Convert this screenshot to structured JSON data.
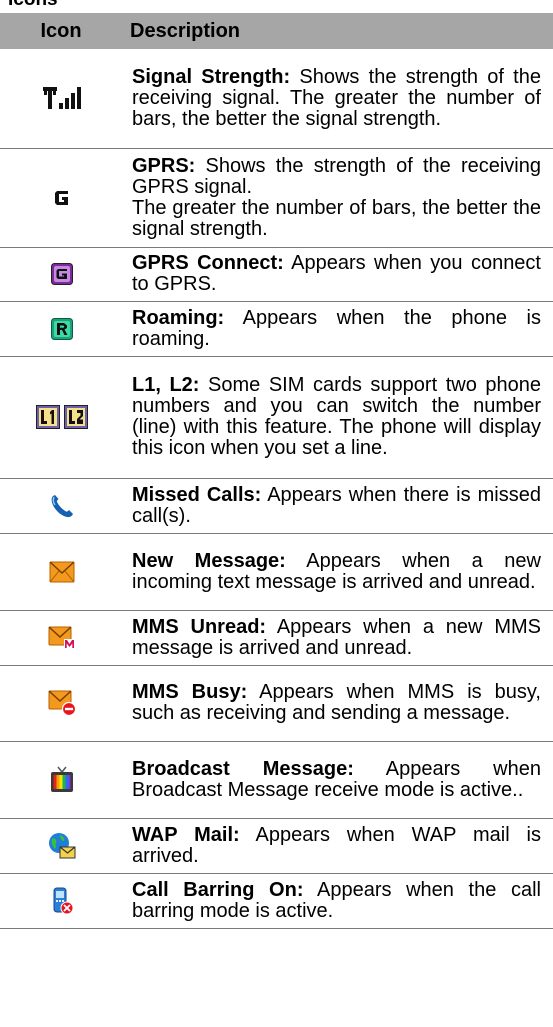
{
  "top_text": "Icons",
  "header": {
    "icon": "Icon",
    "description": "Description"
  },
  "rows": [
    {
      "icon": "signal-strength-icon",
      "title": "Signal Strength:",
      "text": " Shows the strength of the receiving signal. The greater the number of bars, the better the signal strength."
    },
    {
      "icon": "gprs-icon",
      "title": "GPRS:",
      "text": " Shows the strength of the receiving GPRS signal.",
      "text2": "The greater the number of bars, the better the signal strength."
    },
    {
      "icon": "gprs-connect-icon",
      "title": "GPRS Connect:",
      "text": " Appears when you connect to GPRS."
    },
    {
      "icon": "roaming-icon",
      "title": "Roaming:",
      "text": " Appears when the phone is roaming."
    },
    {
      "icon": "line-l1-l2-icon",
      "title": "L1, L2:",
      "text": " Some SIM cards support two phone numbers and you can switch the number (line) with this feature. The phone will display this icon when you set a line."
    },
    {
      "icon": "missed-calls-icon",
      "title": "Missed Calls:",
      "text": " Appears when there is missed call(s)."
    },
    {
      "icon": "new-message-icon",
      "title": "New Message:",
      "text": " Appears when a new incoming text message is arrived and unread."
    },
    {
      "icon": "mms-unread-icon",
      "title": "MMS Unread:",
      "text": " Appears when a new MMS message is arrived and unread."
    },
    {
      "icon": "mms-busy-icon",
      "title": "MMS Busy:",
      "text": " Appears when MMS is busy, such as receiving and sending a message."
    },
    {
      "icon": "broadcast-message-icon",
      "title": "Broadcast Message:",
      "text": " Appears when Broadcast Message receive mode is active.."
    },
    {
      "icon": "wap-mail-icon",
      "title": "WAP Mail:",
      "text": " Appears when WAP mail is arrived."
    },
    {
      "icon": "call-barring-icon",
      "title": "Call Barring On:",
      "text": " Appears when the call barring mode is active."
    }
  ]
}
